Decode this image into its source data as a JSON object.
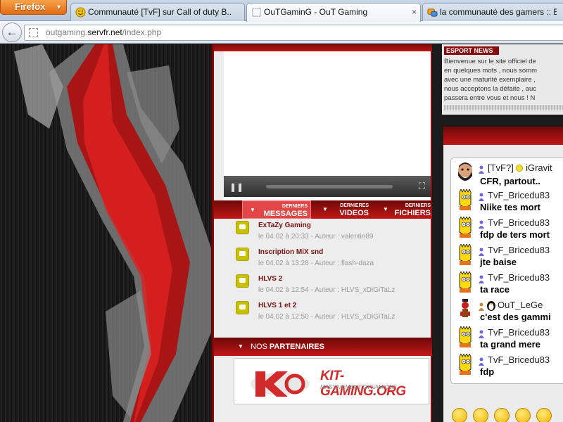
{
  "browser": {
    "menu_button": "Firefox",
    "tabs": [
      {
        "label": "Communauté [TvF] sur Call of duty B...",
        "icon": "smiley-face-icon",
        "active": false
      },
      {
        "label": "OuTGaminG - OuT Gaming",
        "icon": "blank-page-icon",
        "active": true
      },
      {
        "label": "la communauté des gamers :: Bie",
        "icon": "forum-icon",
        "active": false
      }
    ],
    "close_glyph": "×",
    "url_prefix": "outgaming.",
    "url_host": "servfr.net",
    "url_path": "/index.php"
  },
  "media_tabs": {
    "messages": {
      "small": "DERNIERS",
      "big": "MESSAGES"
    },
    "videos": {
      "small": "DERNIERES",
      "big": "VIDEOS"
    },
    "files": {
      "small": "DERNIERS",
      "big": "FICHIERS"
    }
  },
  "messages": [
    {
      "title": "ExTaZy Gaming",
      "meta": "le 04.02 à 20:33 - Auteur : valentin89"
    },
    {
      "title": "Inscription MiX snd",
      "meta": "le 04.02 à 13:28 - Auteur : flash-daza"
    },
    {
      "title": "HLVS 2",
      "meta": "le 04.02 à 12:54 - Auteur : HLVS_xDiGiTaLz"
    },
    {
      "title": "HLVS 1 et 2",
      "meta": "le 04.02 à 12:50 - Auteur : HLVS_xDiGiTaLz"
    }
  ],
  "partners": {
    "title_prefix": "NOS ",
    "title_bold": "PARTENAIRES",
    "banner_name": "KIT-GAMING.ORG",
    "banner_tagline": "MASSIVEMENT DYNAMIQUE"
  },
  "news": {
    "heading": "ESPORT NEWS",
    "lines": [
      "Bienvenue sur le site officiel de",
      "en quelques mots , nous somm",
      "avec une maturité exemplaire ,",
      "nous acceptons la défaite , auc",
      "passera entre vous et nous ! N"
    ]
  },
  "shoutbox": [
    {
      "user": "[TvF?]",
      "user2": "iGravit",
      "text": "CFR, partout..",
      "avatar": "bearded-man-avatar-icon"
    },
    {
      "user": "TvF_Bricedu83",
      "text": "Niike tes mort",
      "avatar": "bart-simpson-avatar-icon"
    },
    {
      "user": "TvF_Bricedu83",
      "text": "fdp de ters mort",
      "avatar": "bart-simpson-avatar-icon"
    },
    {
      "user": "TvF_Bricedu83",
      "text": "jte baise",
      "avatar": "bart-simpson-avatar-icon"
    },
    {
      "user": "TvF_Bricedu83",
      "text": "ta race",
      "avatar": "bart-simpson-avatar-icon"
    },
    {
      "user": "OuT_LeGe",
      "text": "c'est des gammi",
      "avatar": "devil-avatar-icon"
    },
    {
      "user": "TvF_Bricedu83",
      "text": "ta grand mere",
      "avatar": "bart-simpson-avatar-icon"
    },
    {
      "user": "TvF_Bricedu83",
      "text": "fdp",
      "avatar": "bart-simpson-avatar-icon"
    }
  ],
  "colors": {
    "brand_red": "#c31717",
    "dark_red": "#6e0808",
    "message_title": "#7a0f0f",
    "firefox_orange": "#e36c13"
  }
}
